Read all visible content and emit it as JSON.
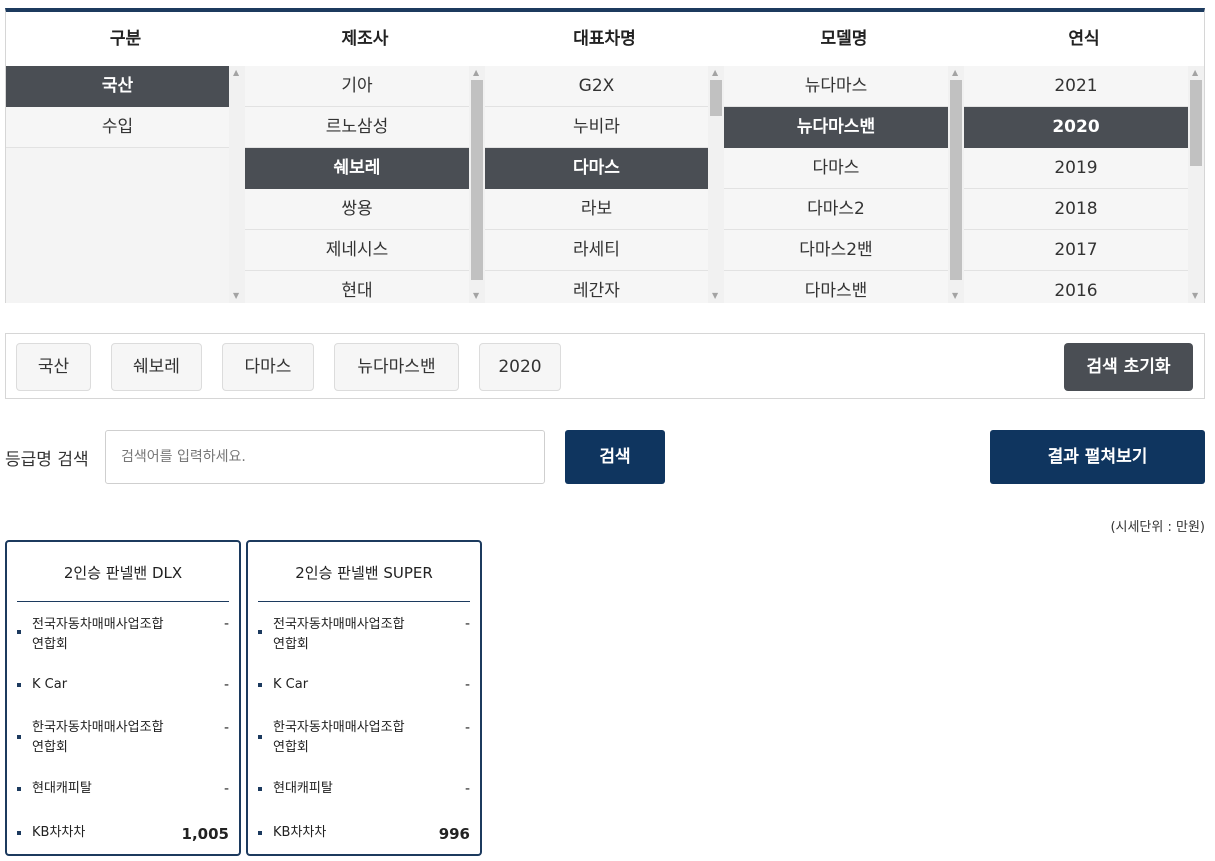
{
  "selector": {
    "columns": [
      {
        "header": "구분",
        "items": [
          "국산",
          "수입"
        ],
        "selected": 0,
        "scrollbar": false
      },
      {
        "header": "제조사",
        "items": [
          "기아",
          "르노삼성",
          "쉐보레",
          "쌍용",
          "제네시스",
          "현대"
        ],
        "selected": 2,
        "scrollbar": true
      },
      {
        "header": "대표차명",
        "items": [
          "G2X",
          "누비라",
          "다마스",
          "라보",
          "라세티",
          "레간자"
        ],
        "selected": 2,
        "scrollbar": true
      },
      {
        "header": "모델명",
        "items": [
          "뉴다마스",
          "뉴다마스밴",
          "다마스",
          "다마스2",
          "다마스2밴",
          "다마스밴"
        ],
        "selected": 1,
        "scrollbar": true
      },
      {
        "header": "연식",
        "items": [
          "2021",
          "2020",
          "2019",
          "2018",
          "2017",
          "2016"
        ],
        "selected": 1,
        "scrollbar": true
      }
    ]
  },
  "chips": [
    "국산",
    "쉐보레",
    "다마스",
    "뉴다마스밴",
    "2020"
  ],
  "reset_label": "검색 초기화",
  "search": {
    "label": "등급명 검색",
    "placeholder": "검색어를 입력하세요.",
    "button_label": "검색",
    "expand_label": "결과 펼쳐보기"
  },
  "unit_note": "(시세단위 : 만원)",
  "cards": [
    {
      "title": "2인승 판넬밴 DLX",
      "rows": [
        {
          "name": "전국자동차매매사업조합연합회",
          "value": "-"
        },
        {
          "name": "K Car",
          "value": "-"
        },
        {
          "name": "한국자동차매매사업조합연합회",
          "value": "-"
        },
        {
          "name": "현대캐피탈",
          "value": "-"
        },
        {
          "name": "KB차차차",
          "value": "1,005"
        }
      ]
    },
    {
      "title": "2인승 판넬밴 SUPER",
      "rows": [
        {
          "name": "전국자동차매매사업조합연합회",
          "value": "-"
        },
        {
          "name": "K Car",
          "value": "-"
        },
        {
          "name": "한국자동차매매사업조합연합회",
          "value": "-"
        },
        {
          "name": "현대캐피탈",
          "value": "-"
        },
        {
          "name": "KB차차차",
          "value": "996"
        }
      ]
    }
  ],
  "colors": {
    "accent": "#0f355f",
    "selected_bg": "#4a4e54",
    "border_top": "#1c3a5e"
  }
}
